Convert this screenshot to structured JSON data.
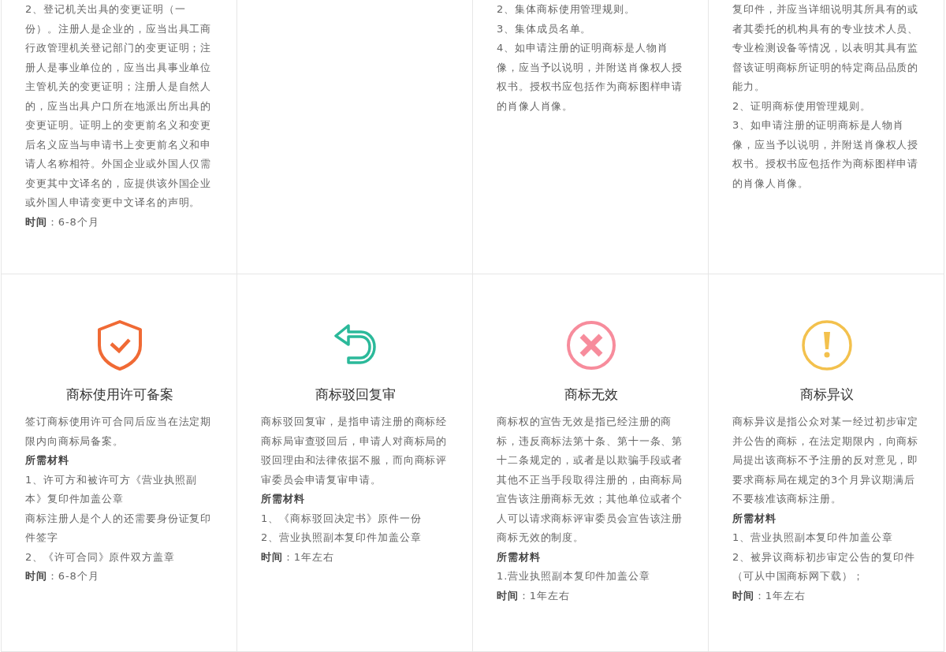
{
  "cards": [
    {
      "lines": [
        {
          "kind": "text",
          "text": "2、登记机关出具的变更证明（一份）。注册人是企业的，应当出具工商行政管理机关登记部门的变更证明；注册人是事业单位的，应当出具事业单位主管机关的变更证明；注册人是自然人的，应当出具户口所在地派出所出具的变更证明。证明上的变更前名义和变更后名义应当与申请书上变更前名义和申请人名称相符。外国企业或外国人仅需变更其中文译名的，应提供该外国企业或外国人申请变更中文译名的声明。"
        },
        {
          "kind": "time",
          "text": "**时间**：6-8个月"
        }
      ]
    },
    {
      "kind": "blank"
    },
    {
      "lines": [
        {
          "kind": "text",
          "text": "2、集体商标使用管理规则。"
        },
        {
          "kind": "text",
          "text": "3、集体成员名单。"
        },
        {
          "kind": "text",
          "text": "4、如申请注册的证明商标是人物肖像，应当予以说明，并附送肖像权人授权书。授权书应包括作为商标图样申请的肖像人肖像。"
        }
      ]
    },
    {
      "lines": [
        {
          "kind": "text",
          "text": "复印件，并应当详细说明其所具有的或者其委托的机构具有的专业技术人员、专业检测设备等情况，以表明其具有监督该证明商标所证明的特定商品品质的能力。"
        },
        {
          "kind": "text",
          "text": "2、证明商标使用管理规则。"
        },
        {
          "kind": "text",
          "text": "3、如申请注册的证明商标是人物肖像，应当予以说明，并附送肖像权人授权书。授权书应包括作为商标图样申请的肖像人肖像。"
        }
      ]
    },
    {
      "kind": "shield",
      "title": "商标使用许可备案",
      "lines": [
        {
          "kind": "text",
          "text": "签订商标使用许可合同后应当在法定期限内向商标局备案。"
        },
        {
          "kind": "heading",
          "text": "所需材料"
        },
        {
          "kind": "text",
          "text": "1、许可方和被许可方《营业执照副本》复印件加盖公章"
        },
        {
          "kind": "text",
          "text": "商标注册人是个人的还需要身份证复印件签字"
        },
        {
          "kind": "text",
          "text": "2、《许可合同》原件双方盖章"
        },
        {
          "kind": "time",
          "text": "**时间**：6-8个月"
        }
      ]
    },
    {
      "kind": "return",
      "title": "商标驳回复审",
      "lines": [
        {
          "kind": "text",
          "text": "商标驳回复审，是指申请注册的商标经商标局审查驳回后，申请人对商标局的驳回理由和法律依据不服，而向商标评审委员会申请复审申请。"
        },
        {
          "kind": "heading",
          "text": "所需材料"
        },
        {
          "kind": "text",
          "text": "1、《商标驳回决定书》原件一份"
        },
        {
          "kind": "text",
          "text": "2、营业执照副本复印件加盖公章"
        },
        {
          "kind": "time",
          "text": "**时间**：1年左右"
        }
      ]
    },
    {
      "kind": "cross",
      "title": "商标无效",
      "lines": [
        {
          "kind": "text",
          "text": "商标权的宣告无效是指已经注册的商标，违反商标法第十条、第十一条、第十二条规定的，或者是以欺骗手段或者其他不正当手段取得注册的，由商标局宣告该注册商标无效；其他单位或者个人可以请求商标评审委员会宣告该注册商标无效的制度。"
        },
        {
          "kind": "heading",
          "text": "所需材料"
        },
        {
          "kind": "text",
          "text": "1.营业执照副本复印件加盖公章"
        },
        {
          "kind": "time",
          "text": "**时间**：1年左右"
        }
      ]
    },
    {
      "kind": "exclaim",
      "title": "商标异议",
      "lines": [
        {
          "kind": "text",
          "text": "商标异议是指公众对某一经过初步审定并公告的商标，在法定期限内，向商标局提出该商标不予注册的反对意见，即要求商标局在规定的3个月异议期满后不要核准该商标注册。"
        },
        {
          "kind": "heading",
          "text": "所需材料"
        },
        {
          "kind": "text",
          "text": "1、营业执照副本复印件加盖公章"
        },
        {
          "kind": "text",
          "text": "2、被异议商标初步审定公告的复印件（可从中国商标网下载）；"
        },
        {
          "kind": "time",
          "text": "**时间**：1年左右"
        }
      ]
    }
  ]
}
